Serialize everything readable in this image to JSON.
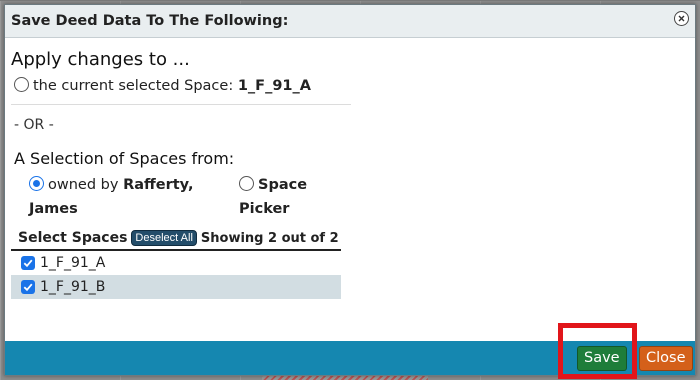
{
  "dialog": {
    "title": "Save Deed Data To The Following:"
  },
  "apply": {
    "heading": "Apply changes to ...",
    "current_prefix": "the current selected Space:",
    "current_space": "1_F_91_A"
  },
  "or_separator": "- OR -",
  "selection": {
    "heading": "A Selection of Spaces from",
    "heading_colon": ":",
    "owned_prefix": "owned by",
    "owner_name": "Rafferty, James",
    "picker_label": "Space Picker",
    "selected_option": "owned"
  },
  "select_spaces": {
    "label": "Select Spaces",
    "deselect_label": "Deselect All",
    "showing_text": "Showing 2 out of 2",
    "items": [
      {
        "label": "1_F_91_A",
        "checked": true
      },
      {
        "label": "1_F_91_B",
        "checked": true
      }
    ]
  },
  "footer": {
    "save_label": "Save",
    "close_label": "Close"
  },
  "colors": {
    "accent": "#1a73e8",
    "footer_bar": "#1587b0",
    "save_button": "#1e7d3a",
    "close_button": "#d4601a",
    "highlight": "#e1151a"
  }
}
